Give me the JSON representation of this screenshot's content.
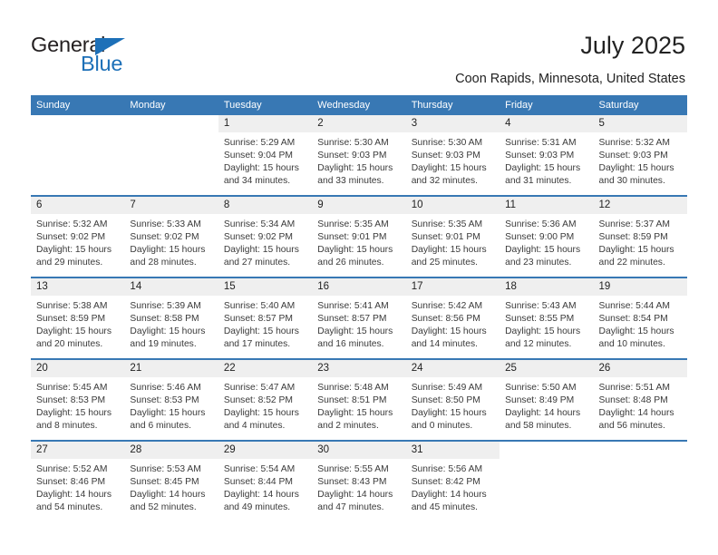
{
  "brand": {
    "name_part1": "General",
    "name_part2": "Blue",
    "accent_color": "#1d70b8"
  },
  "header": {
    "month_title": "July 2025",
    "location": "Coon Rapids, Minnesota, United States",
    "header_bg_color": "#3878b4"
  },
  "weekday_headers": [
    "Sunday",
    "Monday",
    "Tuesday",
    "Wednesday",
    "Thursday",
    "Friday",
    "Saturday"
  ],
  "labels": {
    "sunrise_prefix": "Sunrise:",
    "sunset_prefix": "Sunset:",
    "daylight_prefix": "Daylight:"
  },
  "weeks": [
    [
      {
        "day": "",
        "sunrise": "",
        "sunset": "",
        "daylight_line1": "",
        "daylight_line2": "",
        "blank": true
      },
      {
        "day": "",
        "sunrise": "",
        "sunset": "",
        "daylight_line1": "",
        "daylight_line2": "",
        "blank": true
      },
      {
        "day": "1",
        "sunrise": "Sunrise: 5:29 AM",
        "sunset": "Sunset: 9:04 PM",
        "daylight_line1": "Daylight: 15 hours",
        "daylight_line2": "and 34 minutes."
      },
      {
        "day": "2",
        "sunrise": "Sunrise: 5:30 AM",
        "sunset": "Sunset: 9:03 PM",
        "daylight_line1": "Daylight: 15 hours",
        "daylight_line2": "and 33 minutes."
      },
      {
        "day": "3",
        "sunrise": "Sunrise: 5:30 AM",
        "sunset": "Sunset: 9:03 PM",
        "daylight_line1": "Daylight: 15 hours",
        "daylight_line2": "and 32 minutes."
      },
      {
        "day": "4",
        "sunrise": "Sunrise: 5:31 AM",
        "sunset": "Sunset: 9:03 PM",
        "daylight_line1": "Daylight: 15 hours",
        "daylight_line2": "and 31 minutes."
      },
      {
        "day": "5",
        "sunrise": "Sunrise: 5:32 AM",
        "sunset": "Sunset: 9:03 PM",
        "daylight_line1": "Daylight: 15 hours",
        "daylight_line2": "and 30 minutes."
      }
    ],
    [
      {
        "day": "6",
        "sunrise": "Sunrise: 5:32 AM",
        "sunset": "Sunset: 9:02 PM",
        "daylight_line1": "Daylight: 15 hours",
        "daylight_line2": "and 29 minutes."
      },
      {
        "day": "7",
        "sunrise": "Sunrise: 5:33 AM",
        "sunset": "Sunset: 9:02 PM",
        "daylight_line1": "Daylight: 15 hours",
        "daylight_line2": "and 28 minutes."
      },
      {
        "day": "8",
        "sunrise": "Sunrise: 5:34 AM",
        "sunset": "Sunset: 9:02 PM",
        "daylight_line1": "Daylight: 15 hours",
        "daylight_line2": "and 27 minutes."
      },
      {
        "day": "9",
        "sunrise": "Sunrise: 5:35 AM",
        "sunset": "Sunset: 9:01 PM",
        "daylight_line1": "Daylight: 15 hours",
        "daylight_line2": "and 26 minutes."
      },
      {
        "day": "10",
        "sunrise": "Sunrise: 5:35 AM",
        "sunset": "Sunset: 9:01 PM",
        "daylight_line1": "Daylight: 15 hours",
        "daylight_line2": "and 25 minutes."
      },
      {
        "day": "11",
        "sunrise": "Sunrise: 5:36 AM",
        "sunset": "Sunset: 9:00 PM",
        "daylight_line1": "Daylight: 15 hours",
        "daylight_line2": "and 23 minutes."
      },
      {
        "day": "12",
        "sunrise": "Sunrise: 5:37 AM",
        "sunset": "Sunset: 8:59 PM",
        "daylight_line1": "Daylight: 15 hours",
        "daylight_line2": "and 22 minutes."
      }
    ],
    [
      {
        "day": "13",
        "sunrise": "Sunrise: 5:38 AM",
        "sunset": "Sunset: 8:59 PM",
        "daylight_line1": "Daylight: 15 hours",
        "daylight_line2": "and 20 minutes."
      },
      {
        "day": "14",
        "sunrise": "Sunrise: 5:39 AM",
        "sunset": "Sunset: 8:58 PM",
        "daylight_line1": "Daylight: 15 hours",
        "daylight_line2": "and 19 minutes."
      },
      {
        "day": "15",
        "sunrise": "Sunrise: 5:40 AM",
        "sunset": "Sunset: 8:57 PM",
        "daylight_line1": "Daylight: 15 hours",
        "daylight_line2": "and 17 minutes."
      },
      {
        "day": "16",
        "sunrise": "Sunrise: 5:41 AM",
        "sunset": "Sunset: 8:57 PM",
        "daylight_line1": "Daylight: 15 hours",
        "daylight_line2": "and 16 minutes."
      },
      {
        "day": "17",
        "sunrise": "Sunrise: 5:42 AM",
        "sunset": "Sunset: 8:56 PM",
        "daylight_line1": "Daylight: 15 hours",
        "daylight_line2": "and 14 minutes."
      },
      {
        "day": "18",
        "sunrise": "Sunrise: 5:43 AM",
        "sunset": "Sunset: 8:55 PM",
        "daylight_line1": "Daylight: 15 hours",
        "daylight_line2": "and 12 minutes."
      },
      {
        "day": "19",
        "sunrise": "Sunrise: 5:44 AM",
        "sunset": "Sunset: 8:54 PM",
        "daylight_line1": "Daylight: 15 hours",
        "daylight_line2": "and 10 minutes."
      }
    ],
    [
      {
        "day": "20",
        "sunrise": "Sunrise: 5:45 AM",
        "sunset": "Sunset: 8:53 PM",
        "daylight_line1": "Daylight: 15 hours",
        "daylight_line2": "and 8 minutes."
      },
      {
        "day": "21",
        "sunrise": "Sunrise: 5:46 AM",
        "sunset": "Sunset: 8:53 PM",
        "daylight_line1": "Daylight: 15 hours",
        "daylight_line2": "and 6 minutes."
      },
      {
        "day": "22",
        "sunrise": "Sunrise: 5:47 AM",
        "sunset": "Sunset: 8:52 PM",
        "daylight_line1": "Daylight: 15 hours",
        "daylight_line2": "and 4 minutes."
      },
      {
        "day": "23",
        "sunrise": "Sunrise: 5:48 AM",
        "sunset": "Sunset: 8:51 PM",
        "daylight_line1": "Daylight: 15 hours",
        "daylight_line2": "and 2 minutes."
      },
      {
        "day": "24",
        "sunrise": "Sunrise: 5:49 AM",
        "sunset": "Sunset: 8:50 PM",
        "daylight_line1": "Daylight: 15 hours",
        "daylight_line2": "and 0 minutes."
      },
      {
        "day": "25",
        "sunrise": "Sunrise: 5:50 AM",
        "sunset": "Sunset: 8:49 PM",
        "daylight_line1": "Daylight: 14 hours",
        "daylight_line2": "and 58 minutes."
      },
      {
        "day": "26",
        "sunrise": "Sunrise: 5:51 AM",
        "sunset": "Sunset: 8:48 PM",
        "daylight_line1": "Daylight: 14 hours",
        "daylight_line2": "and 56 minutes."
      }
    ],
    [
      {
        "day": "27",
        "sunrise": "Sunrise: 5:52 AM",
        "sunset": "Sunset: 8:46 PM",
        "daylight_line1": "Daylight: 14 hours",
        "daylight_line2": "and 54 minutes."
      },
      {
        "day": "28",
        "sunrise": "Sunrise: 5:53 AM",
        "sunset": "Sunset: 8:45 PM",
        "daylight_line1": "Daylight: 14 hours",
        "daylight_line2": "and 52 minutes."
      },
      {
        "day": "29",
        "sunrise": "Sunrise: 5:54 AM",
        "sunset": "Sunset: 8:44 PM",
        "daylight_line1": "Daylight: 14 hours",
        "daylight_line2": "and 49 minutes."
      },
      {
        "day": "30",
        "sunrise": "Sunrise: 5:55 AM",
        "sunset": "Sunset: 8:43 PM",
        "daylight_line1": "Daylight: 14 hours",
        "daylight_line2": "and 47 minutes."
      },
      {
        "day": "31",
        "sunrise": "Sunrise: 5:56 AM",
        "sunset": "Sunset: 8:42 PM",
        "daylight_line1": "Daylight: 14 hours",
        "daylight_line2": "and 45 minutes."
      },
      {
        "day": "",
        "sunrise": "",
        "sunset": "",
        "daylight_line1": "",
        "daylight_line2": "",
        "blank": true
      },
      {
        "day": "",
        "sunrise": "",
        "sunset": "",
        "daylight_line1": "",
        "daylight_line2": "",
        "blank": true
      }
    ]
  ]
}
